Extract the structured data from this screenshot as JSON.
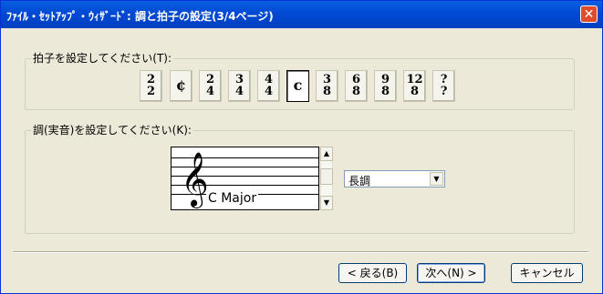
{
  "window": {
    "title": "ﾌｧｲﾙ・ｾｯﾄｱｯﾌﾟ・ｳｨｻﾞｰﾄﾞ: 調と拍子の設定(3/4ページ)",
    "close_label": "✕"
  },
  "time_signature": {
    "group_label": "拍子を設定してください(T):",
    "options": [
      {
        "num": "2",
        "den": "2",
        "symbol": "",
        "selected": false
      },
      {
        "num": "",
        "den": "",
        "symbol": "¢",
        "selected": false
      },
      {
        "num": "2",
        "den": "4",
        "symbol": "",
        "selected": false
      },
      {
        "num": "3",
        "den": "4",
        "symbol": "",
        "selected": false
      },
      {
        "num": "4",
        "den": "4",
        "symbol": "",
        "selected": false
      },
      {
        "num": "",
        "den": "",
        "symbol": "c",
        "selected": true
      },
      {
        "num": "3",
        "den": "8",
        "symbol": "",
        "selected": false
      },
      {
        "num": "6",
        "den": "8",
        "symbol": "",
        "selected": false
      },
      {
        "num": "9",
        "den": "8",
        "symbol": "",
        "selected": false
      },
      {
        "num": "12",
        "den": "8",
        "symbol": "",
        "selected": false
      },
      {
        "num": "?",
        "den": "?",
        "symbol": "",
        "selected": false
      }
    ]
  },
  "key_signature": {
    "group_label": "調(実音)を設定してください(K):",
    "clef": "𝄞",
    "key_name": "C  Major",
    "mode_value": "長調"
  },
  "scrollbar": {
    "up_glyph": "▲",
    "down_glyph": "▼"
  },
  "combo": {
    "arrow_glyph": "▼"
  },
  "buttons": {
    "back": "< 戻る(B)",
    "next": "次へ(N) >",
    "cancel": "キャンセル"
  }
}
